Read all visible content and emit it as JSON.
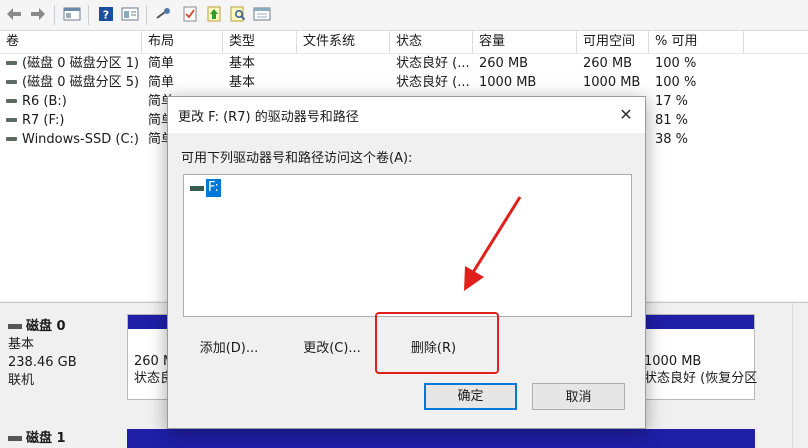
{
  "table": {
    "headers": [
      "卷",
      "布局",
      "类型",
      "文件系统",
      "状态",
      "容量",
      "可用空间",
      "% 可用"
    ],
    "rows": [
      {
        "vol": "(磁盘 0 磁盘分区 1)",
        "layout": "简单",
        "type": "基本",
        "fs": "",
        "status": "状态良好 (...",
        "cap": "260 MB",
        "free": "260 MB",
        "pct": "100 %"
      },
      {
        "vol": "(磁盘 0 磁盘分区 5)",
        "layout": "简单",
        "type": "基本",
        "fs": "",
        "status": "状态良好 (...",
        "cap": "1000 MB",
        "free": "1000 MB",
        "pct": "100 %"
      },
      {
        "vol": "R6 (B:)",
        "layout": "简单",
        "type": "",
        "fs": "",
        "status": "",
        "cap": "",
        "free": "",
        "pct": "17 %"
      },
      {
        "vol": "R7 (F:)",
        "layout": "简单",
        "type": "",
        "fs": "",
        "status": "",
        "cap": "",
        "free": "",
        "pct": "81 %"
      },
      {
        "vol": "Windows-SSD (C:)",
        "layout": "简单",
        "type": "",
        "fs": "",
        "status": "",
        "cap": "",
        "free": "",
        "pct": "38 %"
      }
    ]
  },
  "disks": [
    {
      "name": "磁盘 0",
      "type": "基本",
      "size": "238.46 GB",
      "state": "联机"
    },
    {
      "name": "磁盘 1"
    }
  ],
  "partitions": {
    "left": {
      "line1": "260 M",
      "line2": "状态良"
    },
    "right": {
      "line1": "1000 MB",
      "line2": "状态良好 (恢复分区"
    }
  },
  "dialog": {
    "title": "更改 F: (R7) 的驱动器号和路径",
    "prompt": "可用下列驱动器号和路径访问这个卷(A):",
    "list_item": "F:",
    "add_label": "添加(D)...",
    "change_label": "更改(C)...",
    "delete_label": "删除(R)",
    "ok_label": "确定",
    "cancel_label": "取消",
    "close_glyph": "✕"
  },
  "colors": {
    "partition_bar": "#1f1fa8",
    "selection": "#0078d7",
    "annotation": "#e0201c"
  },
  "icons": [
    "back-arrow-icon",
    "forward-arrow-icon",
    "console-icon",
    "help-icon",
    "properties-icon",
    "key-icon",
    "check-icon",
    "up-icon",
    "search-icon",
    "window-icon"
  ]
}
